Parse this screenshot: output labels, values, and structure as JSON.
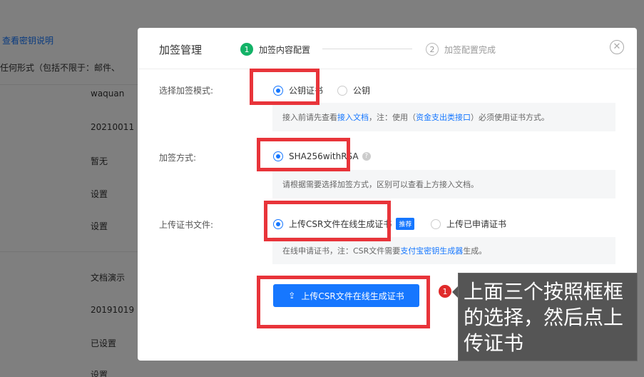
{
  "background": {
    "items": [
      {
        "text": "查看密钥说明",
        "link": true
      },
      {
        "text": "任何形式（包括不限于：邮件、",
        "link": false
      },
      {
        "text": "waquan",
        "link": false
      },
      {
        "text": "20210011",
        "link": false
      },
      {
        "text": "暂无",
        "link": false
      },
      {
        "text": "设置",
        "link": false
      },
      {
        "text": "设置",
        "link": false
      },
      {
        "text": "文档演示",
        "link": false
      },
      {
        "text": "20191019",
        "link": false
      },
      {
        "text": "已设置",
        "link": false
      },
      {
        "text": "设置",
        "link": false
      }
    ]
  },
  "modal": {
    "title": "加签管理",
    "steps": [
      {
        "num": "1",
        "label": "加签内容配置",
        "active": true
      },
      {
        "num": "2",
        "label": "加签配置完成",
        "active": false
      }
    ],
    "close_icon": "close-circle-icon",
    "mode": {
      "label": "选择加签模式:",
      "options": [
        {
          "label": "公钥证书",
          "checked": true
        },
        {
          "label": "公钥",
          "checked": false
        }
      ],
      "note": {
        "prefix": "接入前请先查看",
        "link1": "接入文档",
        "mid": "，注：使用（",
        "link2": "资金支出类接口",
        "suffix": "）必须使用证书方式。"
      }
    },
    "method": {
      "label": "加签方式:",
      "option": "SHA256withRSA",
      "help_icon": "question-circle-icon",
      "note": "请根据需要选择加签方式，区别可以查看上方接入文档。"
    },
    "upload": {
      "label": "上传证书文件:",
      "options": [
        {
          "label": "上传CSR文件在线生成证书",
          "checked": true,
          "tag": "推荐"
        },
        {
          "label": "上传已申请证书",
          "checked": false
        }
      ],
      "note": {
        "prefix": "在线申请证书，注：CSR文件需要",
        "link": "支付宝密钥生成器",
        "suffix": "生成。"
      },
      "button": "上传CSR文件在线生成证书",
      "button_icon": "upload-icon"
    }
  },
  "annotation": {
    "badge": "1",
    "text": "上面三个按照框框的选择，然后点上传证书",
    "color": "#e8343a"
  }
}
